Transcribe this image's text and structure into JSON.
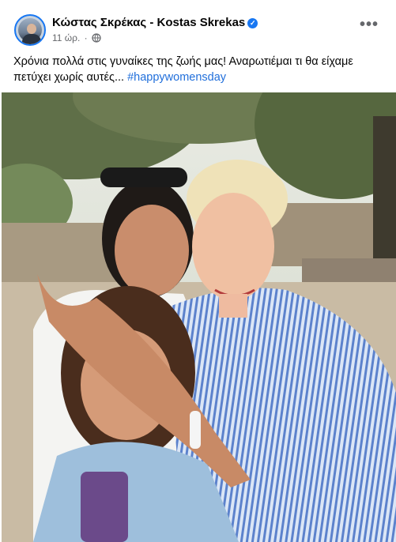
{
  "post": {
    "author": "Κώστας Σκρέκας - Kostas Skrekas",
    "time": "11 ώρ.",
    "separator": "·",
    "more_label": "•••",
    "caption_text": "Χρόνια πολλά στις γυναίκες της ζωής μας! Αναρωτιέμαι τι θα είχαμε πετύχει χωρίς αυτές... ",
    "hashtag": "#happywomensday",
    "verified_icon": "✓"
  },
  "colors": {
    "accent": "#1877f2",
    "hashtag": "#216fdb",
    "meta_text": "#65676b"
  },
  "icons": [
    "verified-badge-icon",
    "globe-icon",
    "more-options-icon"
  ]
}
